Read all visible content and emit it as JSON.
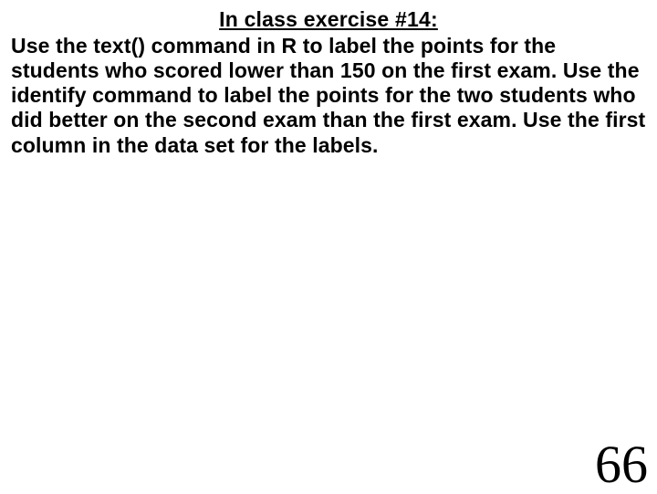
{
  "slide": {
    "heading": "In class exercise #14:",
    "body": "Use the text() command in R to label the points for the students who scored lower than 150 on the first exam.  Use the identify command to label the points for the two students who did better on the second exam than the first exam.  Use the first column in the data set for the labels.",
    "page_number": "66"
  }
}
